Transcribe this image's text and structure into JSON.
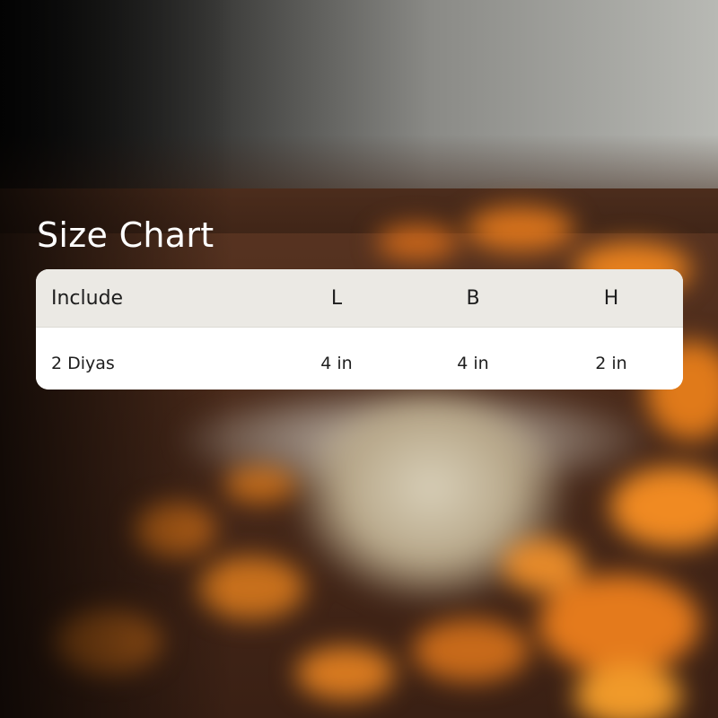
{
  "title": "Size Chart",
  "table": {
    "headers": [
      "Include",
      "L",
      "B",
      "H"
    ],
    "rows": [
      [
        "2 Diyas",
        "4 in",
        "4 in",
        "2 in"
      ]
    ]
  },
  "colors": {
    "header_bg": "#ebe9e4",
    "row_bg": "#ffffff",
    "text": "#1e1e1e",
    "title": "#ffffff",
    "accent_petals": "#e8781e"
  }
}
